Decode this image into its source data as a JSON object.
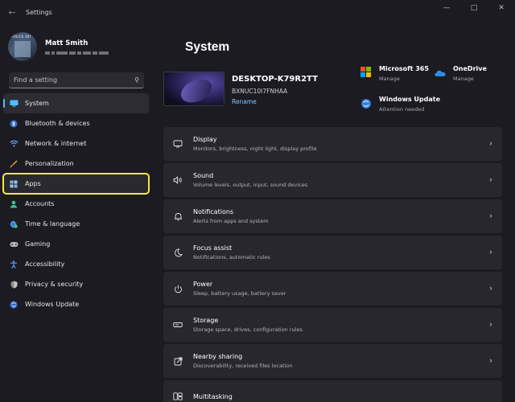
{
  "window": {
    "title": "Settings",
    "back_icon": "arrow-left-icon",
    "controls": [
      "minimize",
      "maximize",
      "close"
    ]
  },
  "user": {
    "name": "Matt Smith",
    "avatar_text": "POLICE 10!"
  },
  "search": {
    "placeholder": "Find a setting"
  },
  "sidebar": {
    "items": [
      {
        "label": "System",
        "icon": "monitor-icon",
        "color": "#4cc2ff"
      },
      {
        "label": "Bluetooth & devices",
        "icon": "bluetooth-icon",
        "color": "#4aa3ff"
      },
      {
        "label": "Network & internet",
        "icon": "wifi-icon",
        "color": "#6fb6ff"
      },
      {
        "label": "Personalization",
        "icon": "brush-icon",
        "color": "#f0a24a"
      },
      {
        "label": "Apps",
        "icon": "apps-icon",
        "color": "#7fb0e6"
      },
      {
        "label": "Accounts",
        "icon": "person-icon",
        "color": "#3ec28f"
      },
      {
        "label": "Time & language",
        "icon": "globe-clock-icon",
        "color": "#4aa3ff"
      },
      {
        "label": "Gaming",
        "icon": "gamepad-icon",
        "color": "#b8b8b8"
      },
      {
        "label": "Accessibility",
        "icon": "accessibility-icon",
        "color": "#4aa3ff"
      },
      {
        "label": "Privacy & security",
        "icon": "shield-icon",
        "color": "#9a9a9a"
      },
      {
        "label": "Windows Update",
        "icon": "sync-icon",
        "color": "#4aa3ff"
      }
    ]
  },
  "main": {
    "title": "System",
    "device": {
      "name": "DESKTOP-K79R2TT",
      "model": "BXNUC10I7FNHAA",
      "rename_label": "Rename"
    },
    "quick_links": [
      {
        "title": "Microsoft 365",
        "subtitle": "Manage",
        "icon": "microsoft-365-icon"
      },
      {
        "title": "OneDrive",
        "subtitle": "Manage",
        "icon": "onedrive-icon"
      },
      {
        "title": "Windows Update",
        "subtitle": "Attention needed",
        "icon": "windows-update-icon"
      }
    ],
    "settings": [
      {
        "title": "Display",
        "subtitle": "Monitors, brightness, night light, display profile",
        "icon": "display-icon"
      },
      {
        "title": "Sound",
        "subtitle": "Volume levels, output, input, sound devices",
        "icon": "speaker-icon"
      },
      {
        "title": "Notifications",
        "subtitle": "Alerts from apps and system",
        "icon": "bell-icon"
      },
      {
        "title": "Focus assist",
        "subtitle": "Notifications, automatic rules",
        "icon": "moon-icon"
      },
      {
        "title": "Power",
        "subtitle": "Sleep, battery usage, battery saver",
        "icon": "power-icon"
      },
      {
        "title": "Storage",
        "subtitle": "Storage space, drives, configuration rules",
        "icon": "storage-icon"
      },
      {
        "title": "Nearby sharing",
        "subtitle": "Discoverability, received files location",
        "icon": "share-icon"
      },
      {
        "title": "Multitasking",
        "subtitle": "",
        "icon": "multitasking-icon"
      }
    ]
  },
  "colors": {
    "background": "#1c1b22",
    "card": "#28272e",
    "accent": "#4cc2ff",
    "highlight_outline": "#f2ec3b",
    "link": "#7cc7ff"
  }
}
